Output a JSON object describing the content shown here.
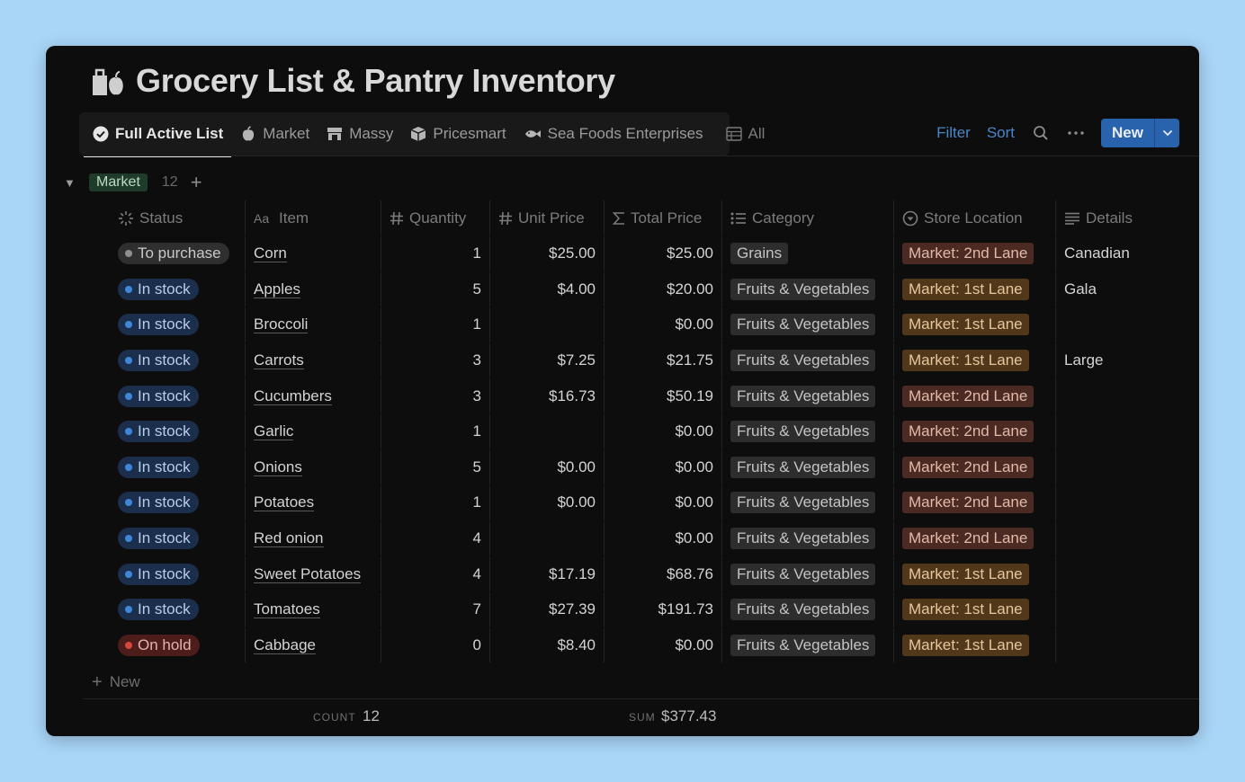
{
  "page": {
    "title": "Grocery List & Pantry Inventory",
    "title_icon": "grocery-bag-apple-icon"
  },
  "tabs": [
    {
      "label": "Full Active List",
      "icon": "check-circle-icon",
      "active": true
    },
    {
      "label": "Market",
      "icon": "apple-icon"
    },
    {
      "label": "Massy",
      "icon": "store-icon"
    },
    {
      "label": "Pricesmart",
      "icon": "box-icon"
    },
    {
      "label": "Sea Foods Enterprises",
      "icon": "fish-icon"
    },
    {
      "label": "All",
      "icon": "table-icon"
    }
  ],
  "toolbar": {
    "filter_label": "Filter",
    "sort_label": "Sort",
    "new_label": "New",
    "accent": "#2a63ad",
    "link_color": "#4a86c9"
  },
  "group": {
    "name": "Market",
    "count": "12"
  },
  "columns": {
    "status": "Status",
    "item": "Item",
    "quantity": "Quantity",
    "unit_price": "Unit Price",
    "total_price": "Total Price",
    "category": "Category",
    "store_location": "Store Location",
    "details": "Details"
  },
  "status_colors": {
    "To purchase": {
      "bg": "#2f2f2f",
      "fg": "#c9c9c9",
      "dot": "#8e8e8e"
    },
    "In stock": {
      "bg": "#1b2f4d",
      "fg": "#b7cde9",
      "dot": "#3f86d9"
    },
    "On hold": {
      "bg": "#4c1d1a",
      "fg": "#e2b3ae",
      "dot": "#d9473c"
    }
  },
  "category_colors": {
    "Grains": {
      "bg": "#2d2d2d",
      "fg": "#c4c4c4"
    },
    "Fruits & Vegetables": {
      "bg": "#2d2d2d",
      "fg": "#c4c4c4"
    }
  },
  "location_colors": {
    "Market: 2nd Lane": {
      "bg": "#4a2a22",
      "fg": "#e2b9a8"
    },
    "Market: 1st Lane": {
      "bg": "#52381a",
      "fg": "#e6c79c"
    }
  },
  "rows": [
    {
      "status": "To purchase",
      "item": "Corn",
      "quantity": "1",
      "unit_price": "$25.00",
      "total_price": "$25.00",
      "category": "Grains",
      "store_location": "Market: 2nd Lane",
      "details": "Canadian"
    },
    {
      "status": "In stock",
      "item": "Apples",
      "quantity": "5",
      "unit_price": "$4.00",
      "total_price": "$20.00",
      "category": "Fruits & Vegetables",
      "store_location": "Market: 1st Lane",
      "details": "Gala"
    },
    {
      "status": "In stock",
      "item": "Broccoli",
      "quantity": "1",
      "unit_price": "",
      "total_price": "$0.00",
      "category": "Fruits & Vegetables",
      "store_location": "Market: 1st Lane",
      "details": ""
    },
    {
      "status": "In stock",
      "item": "Carrots",
      "quantity": "3",
      "unit_price": "$7.25",
      "total_price": "$21.75",
      "category": "Fruits & Vegetables",
      "store_location": "Market: 1st Lane",
      "details": "Large"
    },
    {
      "status": "In stock",
      "item": "Cucumbers",
      "quantity": "3",
      "unit_price": "$16.73",
      "total_price": "$50.19",
      "category": "Fruits & Vegetables",
      "store_location": "Market: 2nd Lane",
      "details": ""
    },
    {
      "status": "In stock",
      "item": "Garlic",
      "quantity": "1",
      "unit_price": "",
      "total_price": "$0.00",
      "category": "Fruits & Vegetables",
      "store_location": "Market: 2nd Lane",
      "details": ""
    },
    {
      "status": "In stock",
      "item": "Onions",
      "quantity": "5",
      "unit_price": "$0.00",
      "total_price": "$0.00",
      "category": "Fruits & Vegetables",
      "store_location": "Market: 2nd Lane",
      "details": ""
    },
    {
      "status": "In stock",
      "item": "Potatoes",
      "quantity": "1",
      "unit_price": "$0.00",
      "total_price": "$0.00",
      "category": "Fruits & Vegetables",
      "store_location": "Market: 2nd Lane",
      "details": ""
    },
    {
      "status": "In stock",
      "item": "Red onion",
      "quantity": "4",
      "unit_price": "",
      "total_price": "$0.00",
      "category": "Fruits & Vegetables",
      "store_location": "Market: 2nd Lane",
      "details": ""
    },
    {
      "status": "In stock",
      "item": "Sweet Potatoes",
      "quantity": "4",
      "unit_price": "$17.19",
      "total_price": "$68.76",
      "category": "Fruits & Vegetables",
      "store_location": "Market: 1st Lane",
      "details": ""
    },
    {
      "status": "In stock",
      "item": "Tomatoes",
      "quantity": "7",
      "unit_price": "$27.39",
      "total_price": "$191.73",
      "category": "Fruits & Vegetables",
      "store_location": "Market: 1st Lane",
      "details": ""
    },
    {
      "status": "On hold",
      "item": "Cabbage",
      "quantity": "0",
      "unit_price": "$8.40",
      "total_price": "$0.00",
      "category": "Fruits & Vegetables",
      "store_location": "Market: 1st Lane",
      "details": ""
    }
  ],
  "new_row_label": "New",
  "footer": {
    "count_label": "COUNT",
    "count_value": "12",
    "sum_label": "SUM",
    "sum_value": "$377.43"
  }
}
